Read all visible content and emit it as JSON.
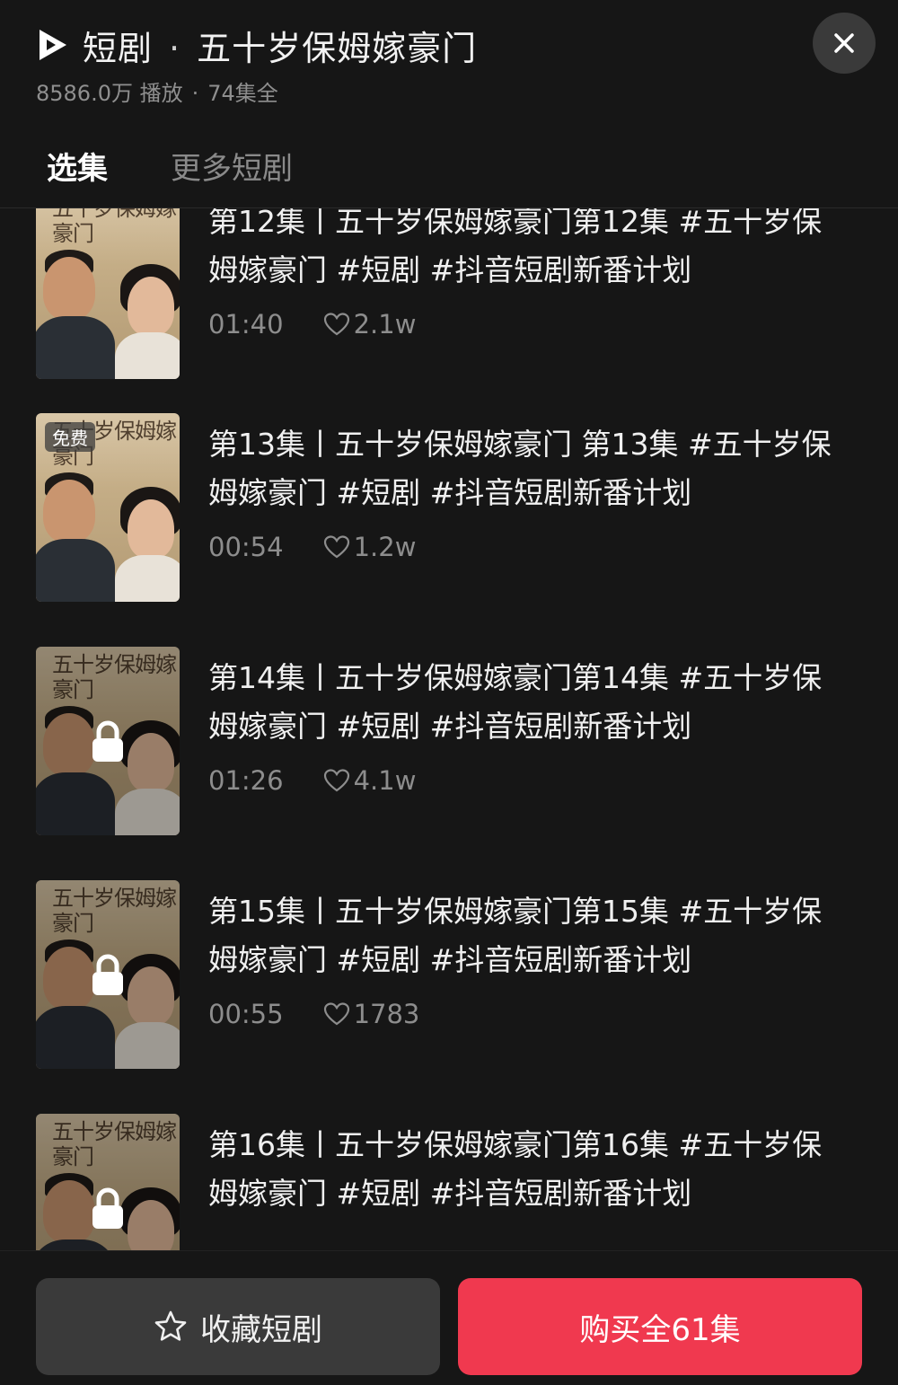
{
  "header": {
    "app_label": "短剧",
    "separator": "·",
    "drama_title": "五十岁保姆嫁豪门",
    "plays": "8586.0万 播放",
    "meta_sep": "·",
    "episode_total": "74集全",
    "close_icon": "close-icon",
    "logo_icon": "play-logo-icon"
  },
  "tabs": [
    {
      "label": "选集",
      "active": true
    },
    {
      "label": "更多短剧",
      "active": false
    }
  ],
  "poster_text": "五十岁保姆嫁豪门",
  "episodes": [
    {
      "title": "第12集丨五十岁保姆嫁豪门第12集 #五十岁保姆嫁豪门 #短剧 #抖音短剧新番计划",
      "duration": "01:40",
      "likes": "2.1w",
      "free": false,
      "locked": false
    },
    {
      "title": "第13集丨五十岁保姆嫁豪门 第13集 #五十岁保姆嫁豪门 #短剧 #抖音短剧新番计划",
      "duration": "00:54",
      "likes": "1.2w",
      "free": true,
      "free_label": "免费",
      "locked": false
    },
    {
      "title": "第14集丨五十岁保姆嫁豪门第14集 #五十岁保姆嫁豪门 #短剧 #抖音短剧新番计划",
      "duration": "01:26",
      "likes": "4.1w",
      "free": false,
      "locked": true
    },
    {
      "title": "第15集丨五十岁保姆嫁豪门第15集 #五十岁保姆嫁豪门 #短剧 #抖音短剧新番计划",
      "duration": "00:55",
      "likes": "1783",
      "free": false,
      "locked": true
    },
    {
      "title": "第16集丨五十岁保姆嫁豪门第16集 #五十岁保姆嫁豪门 #短剧 #抖音短剧新番计划",
      "duration": "",
      "likes": "",
      "free": false,
      "locked": true
    }
  ],
  "bottom": {
    "favorite_label": "收藏短剧",
    "favorite_icon": "star-icon",
    "buy_label": "购买全61集"
  },
  "colors": {
    "background": "#161616",
    "accent_buy": "#f0394f",
    "tab_indicator": "#e8c46a",
    "secondary_text": "#8d8d8d"
  }
}
